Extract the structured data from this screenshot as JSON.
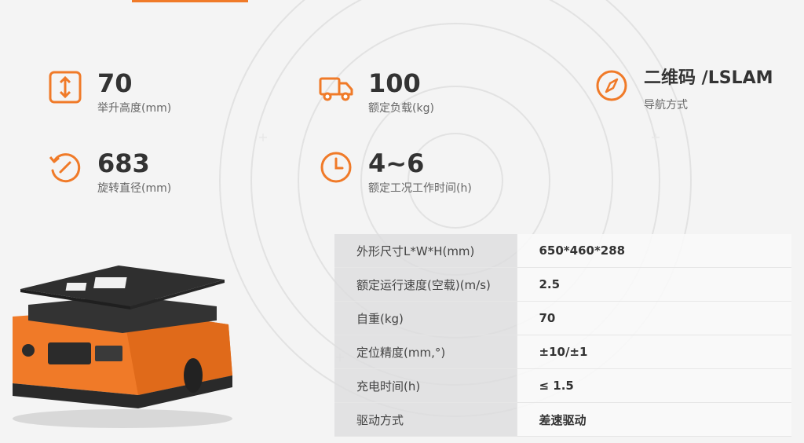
{
  "accent_color": "#f07a28",
  "specs": [
    {
      "icon": "vertical-arrows-icon",
      "value": "70",
      "label": "举升高度(mm)"
    },
    {
      "icon": "truck-icon",
      "value": "100",
      "label": "额定负载(kg)"
    },
    {
      "icon": "compass-icon",
      "value": "二维码 /LSLAM",
      "label": "导航方式"
    },
    {
      "icon": "rotate-icon",
      "value": "683",
      "label": "旋转直径(mm)"
    },
    {
      "icon": "clock-icon",
      "value": "4~6",
      "label": "额定工况工作时间(h)"
    }
  ],
  "table": [
    {
      "key": "外形尺寸L*W*H(mm)",
      "value": "650*460*288"
    },
    {
      "key": "额定运行速度(空载)(m/s)",
      "value": "2.5"
    },
    {
      "key": "自重(kg)",
      "value": "70"
    },
    {
      "key": "定位精度(mm,°)",
      "value": "±10/±1"
    },
    {
      "key": "充电时间(h)",
      "value": "≤ 1.5"
    },
    {
      "key": "驱动方式",
      "value": "差速驱动"
    }
  ]
}
